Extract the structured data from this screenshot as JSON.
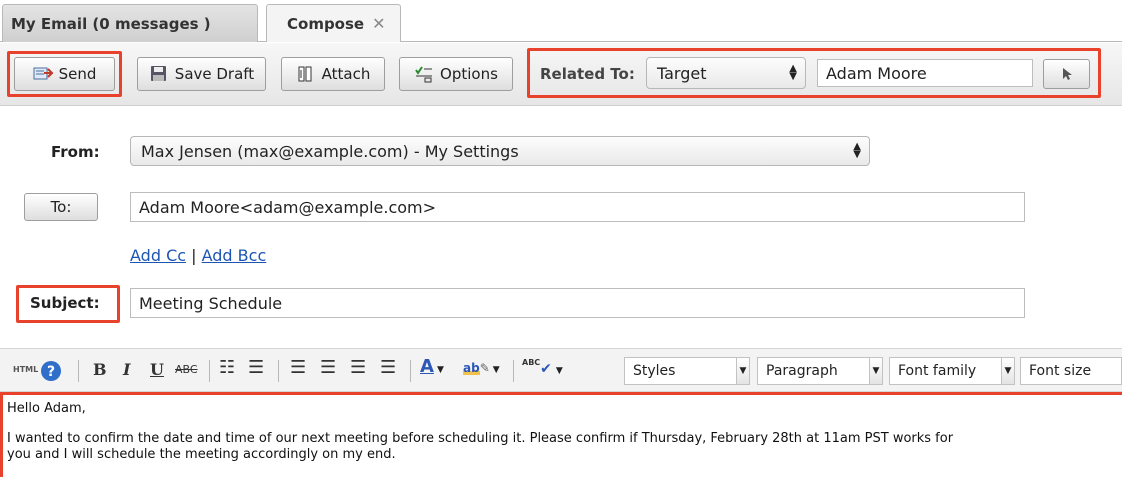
{
  "tabs": [
    {
      "label": "My Email (0 messages )"
    },
    {
      "label": "Compose",
      "close": "✕"
    }
  ],
  "toolbar": {
    "send": "Send",
    "save_draft": "Save Draft",
    "attach": "Attach",
    "options": "Options",
    "related_to_label": "Related To:",
    "related_type": "Target",
    "related_name": "Adam Moore"
  },
  "form": {
    "from_label": "From:",
    "from_value": "Max Jensen (max@example.com) - My Settings",
    "to_button": "To:",
    "to_value": "Adam Moore<adam@example.com>",
    "add_cc": "Add Cc",
    "link_sep": "|",
    "add_bcc": "Add Bcc",
    "subject_label": "Subject:",
    "subject_value": "Meeting Schedule"
  },
  "editor": {
    "html_label": "HTML",
    "styles": "Styles",
    "paragraph": "Paragraph",
    "font_family": "Font family",
    "font_size": "Font size",
    "body_lines": [
      "Hello Adam,",
      "I wanted to confirm the date and time of our next meeting before scheduling it. Please confirm if Thursday, February 28th at 11am PST works for",
      "you and I will schedule the meeting accordingly on my end."
    ]
  },
  "colors": {
    "highlight": "#e8412c",
    "link": "#1d55b3"
  }
}
